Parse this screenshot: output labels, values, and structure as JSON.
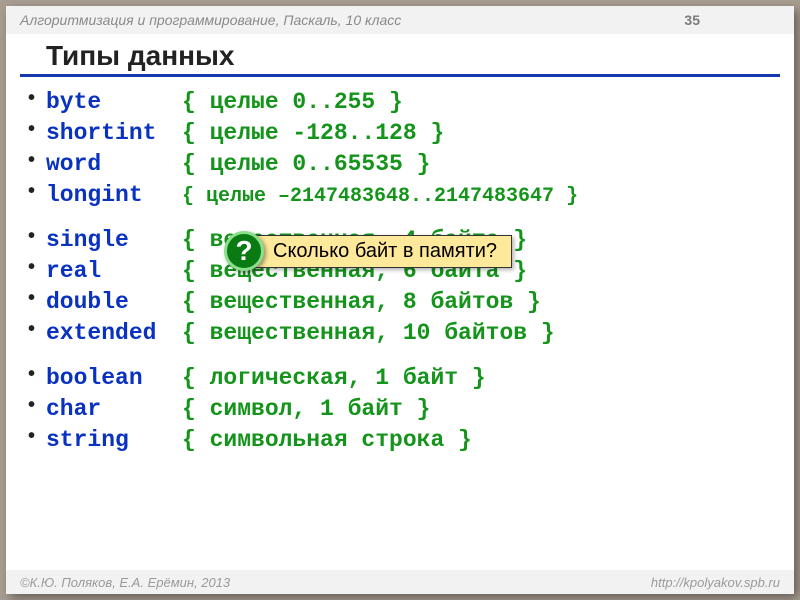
{
  "header": {
    "course": "Алгоритмизация и программирование, Паскаль, 10 класс",
    "page": "35"
  },
  "title": "Типы данных",
  "groups": [
    {
      "rows": [
        {
          "kw": "byte",
          "comment": "{ целые 0..255 }"
        },
        {
          "kw": "shortint",
          "comment": "{ целые -128..128 }"
        },
        {
          "kw": "word",
          "comment": "{ целые 0..65535 }"
        },
        {
          "kw": "longint",
          "comment": "{ целые –2147483648..2147483647 }",
          "small": true
        }
      ]
    },
    {
      "rows": [
        {
          "kw": "single",
          "comment": "{ вещественная, 4 байта }"
        },
        {
          "kw": "real",
          "comment": "{ вещественная, 6 байта }"
        },
        {
          "kw": "double",
          "comment": "{ вещественная, 8 байтов }"
        },
        {
          "kw": "extended",
          "comment": "{ вещественная, 10 байтов }"
        }
      ]
    },
    {
      "rows": [
        {
          "kw": "boolean",
          "comment": "{ логическая, 1 байт }"
        },
        {
          "kw": "char",
          "comment": "{ символ, 1 байт }"
        },
        {
          "kw": "string",
          "comment": "{ символьная строка }"
        }
      ]
    }
  ],
  "callout": {
    "symbol": "?",
    "text": "Сколько байт в памяти?"
  },
  "footer": {
    "authors": "©К.Ю. Поляков, Е.А. Ерёмин, 2013",
    "url": "http://kpolyakov.spb.ru"
  }
}
